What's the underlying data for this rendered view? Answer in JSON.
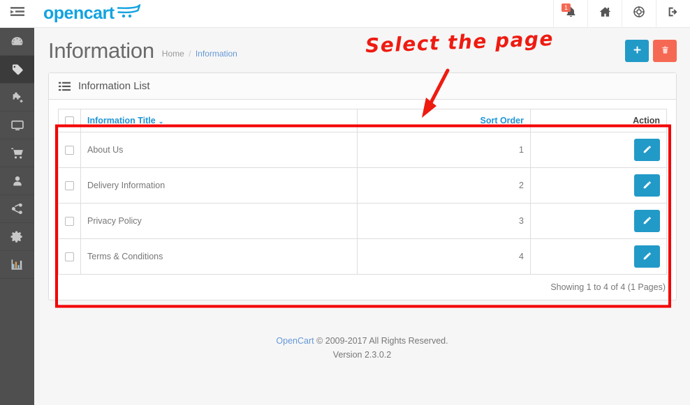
{
  "sidebar": {
    "toggle_label": "toggle-menu",
    "items": [
      {
        "name": "dashboard",
        "icon": "gauge-icon",
        "active": false
      },
      {
        "name": "catalog",
        "icon": "tags-icon",
        "active": true
      },
      {
        "name": "extensions",
        "icon": "puzzle-icon",
        "active": false
      },
      {
        "name": "design",
        "icon": "monitor-icon",
        "active": false
      },
      {
        "name": "sales",
        "icon": "cart-icon",
        "active": false
      },
      {
        "name": "customers",
        "icon": "user-icon",
        "active": false
      },
      {
        "name": "marketing",
        "icon": "share-icon",
        "active": false
      },
      {
        "name": "system",
        "icon": "gear-icon",
        "active": false
      },
      {
        "name": "reports",
        "icon": "bar-chart-icon",
        "active": false
      }
    ]
  },
  "topbar": {
    "brand": "opencart",
    "notifications_badge": "1",
    "buttons": [
      {
        "name": "notifications",
        "icon": "bell-icon"
      },
      {
        "name": "storefront",
        "icon": "home-icon"
      },
      {
        "name": "help",
        "icon": "life-ring-icon"
      },
      {
        "name": "logout",
        "icon": "logout-icon"
      }
    ]
  },
  "page": {
    "title": "Information",
    "breadcrumb": [
      {
        "label": "Home",
        "active": false
      },
      {
        "label": "Information",
        "active": true
      }
    ],
    "actions": {
      "add_label": "+",
      "add_name": "add-new-button",
      "delete_name": "delete-button"
    }
  },
  "panel": {
    "title": "Information List",
    "icon": "list-icon"
  },
  "table": {
    "headers": {
      "select_all": "",
      "title": "Information Title",
      "sort_order": "Sort Order",
      "action": "Action"
    },
    "sort_caret": "⌄",
    "rows": [
      {
        "title": "About Us",
        "sort_order": "1",
        "checked": false
      },
      {
        "title": "Delivery Information",
        "sort_order": "2",
        "checked": false
      },
      {
        "title": "Privacy Policy",
        "sort_order": "3",
        "checked": false
      },
      {
        "title": "Terms & Conditions",
        "sort_order": "4",
        "checked": false
      }
    ],
    "results": "Showing 1 to 4 of 4 (1 Pages)"
  },
  "footer": {
    "link": "OpenCart",
    "copyright": "© 2009-2017 All Rights Reserved.",
    "version": "Version 2.3.0.2"
  },
  "annotations": {
    "note": "Select the page",
    "arrow_color": "#ee1b11",
    "highlight_color": "#f40000"
  },
  "colors": {
    "accent_blue": "#229ac8",
    "link_blue": "#2196d6",
    "danger_red": "#f56954",
    "sidebar_dark": "#4f4f4f",
    "annotation_red": "#ee1b11"
  }
}
